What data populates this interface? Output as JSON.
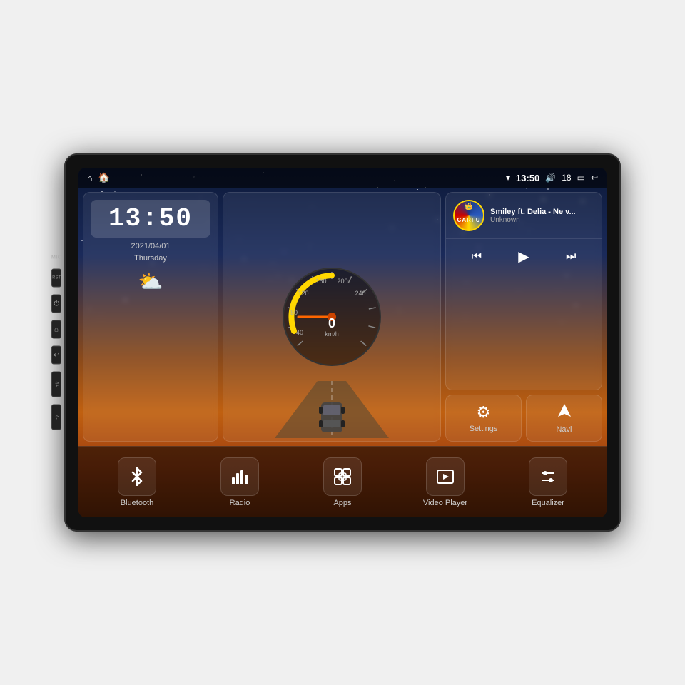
{
  "device": {
    "label": "Car Android Head Unit"
  },
  "status_bar": {
    "left_icons": [
      "home",
      "house-filled"
    ],
    "time": "13:50",
    "wifi_icon": "wifi",
    "volume_icon": "volume",
    "volume_level": "18",
    "window_icon": "window",
    "back_icon": "back"
  },
  "clock_widget": {
    "time": "13:50",
    "date_line1": "2021/04/01",
    "date_line2": "Thursday",
    "weather_icon": "⛅"
  },
  "speedometer": {
    "speed_value": "0",
    "unit": "km/h",
    "max": "240"
  },
  "music_widget": {
    "logo_text": "CARFU",
    "title": "Smiley ft. Delia - Ne v...",
    "artist": "Unknown",
    "controls": {
      "prev": "⏮",
      "play": "▶",
      "next": "⏭"
    }
  },
  "quick_buttons": [
    {
      "id": "settings",
      "icon": "⚙",
      "label": "Settings"
    },
    {
      "id": "navi",
      "icon": "🧭",
      "label": "Navi"
    }
  ],
  "bottom_bar": [
    {
      "id": "bluetooth",
      "label": "Bluetooth"
    },
    {
      "id": "radio",
      "label": "Radio"
    },
    {
      "id": "apps",
      "label": "Apps"
    },
    {
      "id": "video-player",
      "label": "Video Player"
    },
    {
      "id": "equalizer",
      "label": "Equalizer"
    }
  ],
  "side_buttons": [
    {
      "id": "mic",
      "label": "MIC"
    },
    {
      "id": "rst",
      "label": "RST"
    },
    {
      "id": "power",
      "label": ""
    },
    {
      "id": "home-side",
      "label": ""
    },
    {
      "id": "back-side",
      "label": ""
    },
    {
      "id": "vol-up",
      "label": "4+"
    },
    {
      "id": "vol-down",
      "label": "4-"
    }
  ]
}
